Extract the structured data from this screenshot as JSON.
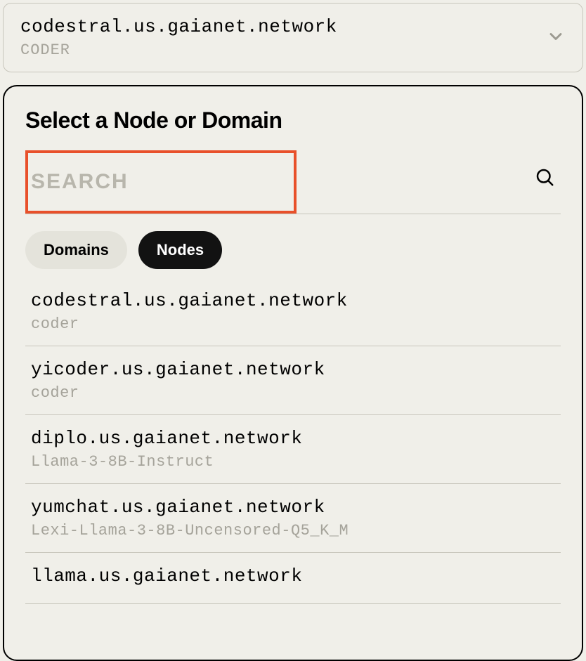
{
  "dropdown": {
    "selected_title": "codestral.us.gaianet.network",
    "selected_subtitle": "CODER"
  },
  "panel": {
    "title": "Select a Node or Domain"
  },
  "search": {
    "placeholder": "SEARCH",
    "value": ""
  },
  "tabs": {
    "domains_label": "Domains",
    "nodes_label": "Nodes",
    "active": "nodes"
  },
  "items": [
    {
      "title": "codestral.us.gaianet.network",
      "subtitle": "coder"
    },
    {
      "title": "yicoder.us.gaianet.network",
      "subtitle": "coder"
    },
    {
      "title": "diplo.us.gaianet.network",
      "subtitle": "Llama-3-8B-Instruct"
    },
    {
      "title": "yumchat.us.gaianet.network",
      "subtitle": "Lexi-Llama-3-8B-Uncensored-Q5_K_M"
    },
    {
      "title": "llama.us.gaianet.network",
      "subtitle": ""
    }
  ]
}
